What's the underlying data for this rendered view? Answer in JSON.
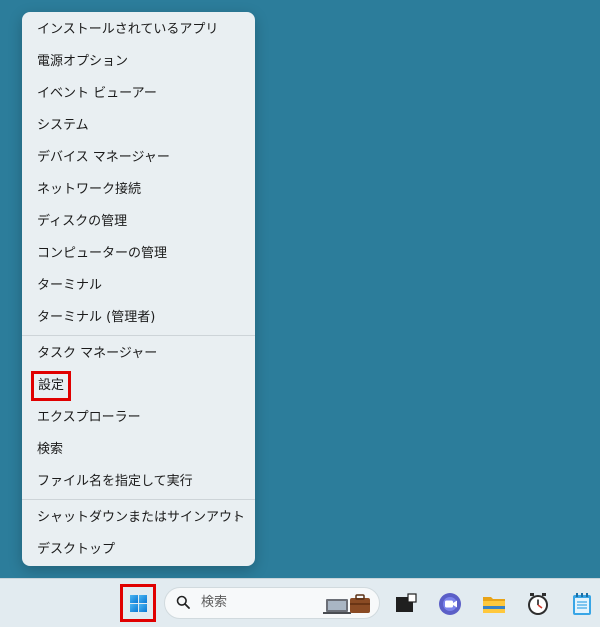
{
  "context_menu": {
    "items": [
      "インストールされているアプリ",
      "電源オプション",
      "イベント ビューアー",
      "システム",
      "デバイス マネージャー",
      "ネットワーク接続",
      "ディスクの管理",
      "コンピューターの管理",
      "ターミナル",
      "ターミナル (管理者)",
      "タスク マネージャー",
      "設定",
      "エクスプローラー",
      "検索",
      "ファイル名を指定して実行",
      "シャットダウンまたはサインアウト",
      "デスクトップ"
    ],
    "submenu_chevron": "›"
  },
  "taskbar": {
    "search_placeholder": "検索",
    "icons": [
      "windows-start-icon",
      "search-icon",
      "task-view-icon",
      "chat-icon",
      "file-explorer-icon",
      "clock-app-icon",
      "notepad-icon"
    ]
  },
  "colors": {
    "desktop_background": "#2c7d9b",
    "menu_background": "#e9eff2",
    "highlight": "#e00000",
    "taskbar_background": "#e2ebf0"
  }
}
